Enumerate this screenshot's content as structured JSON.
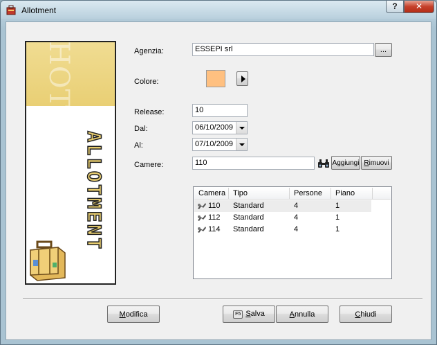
{
  "window": {
    "title": "Allotment",
    "help_label": "?",
    "close_label": "✕"
  },
  "banner": {
    "watermark": "HOTEL",
    "vertical_text": "ALLOTMENT"
  },
  "form": {
    "agenzia_label": "Agenzia:",
    "agenzia_value": "ESSEPI srl",
    "browse_label": "...",
    "colore_label": "Colore:",
    "colore_value": "#ffc080",
    "release_label": "Release:",
    "release_value": "10",
    "dal_label": "Dal:",
    "dal_value": "06/10/2009",
    "al_label": "Al:",
    "al_value": "07/10/2009",
    "camere_label": "Camere:",
    "camere_value": "110",
    "search_icon": "binoculars-icon",
    "aggiungi_label": "Aggiungi",
    "rimuovi_first": "R",
    "rimuovi_rest": "imuovi"
  },
  "table": {
    "columns": [
      "Camera",
      "Tipo",
      "Persone",
      "Piano"
    ],
    "rows": [
      {
        "camera": "110",
        "tipo": "Standard",
        "persone": "4",
        "piano": "1",
        "selected": true
      },
      {
        "camera": "112",
        "tipo": "Standard",
        "persone": "4",
        "piano": "1",
        "selected": false
      },
      {
        "camera": "114",
        "tipo": "Standard",
        "persone": "4",
        "piano": "1",
        "selected": false
      }
    ]
  },
  "buttons": {
    "modifica_first": "M",
    "modifica_rest": "odifica",
    "salva_key": "F5",
    "salva_first": "S",
    "salva_rest": "alva",
    "annulla_first": "A",
    "annulla_rest": "nnulla",
    "chiudi_first": "C",
    "chiudi_rest": "hiudi"
  }
}
